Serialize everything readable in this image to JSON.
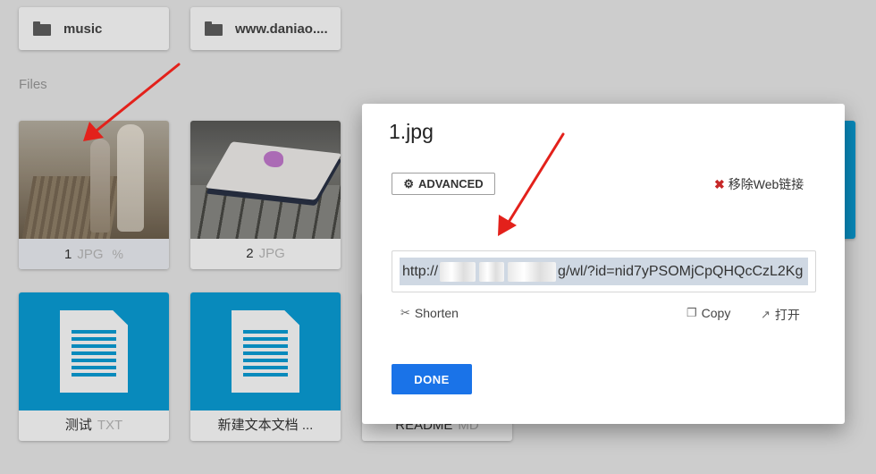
{
  "folders": [
    {
      "name": "music"
    },
    {
      "name": "www.daniao...."
    }
  ],
  "section_label": "Files",
  "files": [
    {
      "name": "1",
      "ext": "JPG",
      "link_icon": "link-icon"
    },
    {
      "name": "2",
      "ext": "JPG"
    },
    {
      "name": "测试",
      "ext": "TXT"
    },
    {
      "name": "新建文本文档 ...",
      "ext": ""
    },
    {
      "name": "README",
      "ext": "MD"
    }
  ],
  "dialog": {
    "title": "1.jpg",
    "advanced_label": "ADVANCED",
    "remove_label": "移除Web链接",
    "url_prefix": "http://",
    "url_suffix": "g/wl/?id=nid7yPSOMjCpQHQcCzL2Kg",
    "shorten_label": "Shorten",
    "copy_label": "Copy",
    "open_label": "打开",
    "done_label": "DONE"
  },
  "colors": {
    "accent": "#1a73e8",
    "remove_icon": "#c62828",
    "arrow": "#e3211b",
    "doc_thumb": "#0a9fd8"
  }
}
